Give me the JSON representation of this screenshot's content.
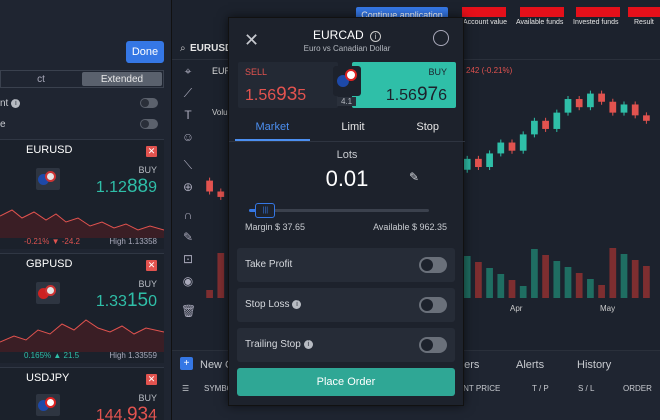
{
  "left_panel": {
    "done_label": "Done",
    "segment": {
      "left_label": "ct",
      "right_label": "Extended"
    },
    "options": [
      {
        "label": "nt",
        "has_info": true
      },
      {
        "label": "e",
        "has_info": false
      }
    ],
    "cards": [
      {
        "symbol": "EURUSD",
        "side": "BUY",
        "price_main": "1.12",
        "price_big": "88",
        "price_tail": "9",
        "price_color": "green",
        "change": "-0.21%",
        "change_abs": "-24.2",
        "change_color": "#e2534f",
        "high": "High 1.13358"
      },
      {
        "symbol": "GBPUSD",
        "side": "BUY",
        "price_main": "1.33",
        "price_big": "15",
        "price_tail": "0",
        "price_color": "green",
        "change": "0.165%",
        "change_abs": "21.5",
        "change_color": "#2fbfa8",
        "high": "High 1.33559"
      },
      {
        "symbol": "USDJPY",
        "side": "BUY",
        "price_main": "144.",
        "price_big": "93",
        "price_tail": "4",
        "price_color": "red",
        "change": "",
        "change_abs": "",
        "change_color": "#e2534f",
        "high": ""
      }
    ]
  },
  "chart_header": {
    "symbol": "EURUSD",
    "button_label": "Continue application",
    "stats": [
      {
        "label": "Account value"
      },
      {
        "label": "Available funds"
      },
      {
        "label": "Invested funds"
      },
      {
        "label": "Result"
      }
    ],
    "legend_text": "242 (-0.21%)",
    "symbol_short": "EUR",
    "volume_short": "Volu"
  },
  "chart_data": {
    "type": "candlestick",
    "x_tick_labels": [
      "Apr",
      "May"
    ],
    "note": "Dense daily candles; bullish green (#2fbfa8), bearish red (#e2534f), with volume bars beneath.",
    "candles": [
      {
        "o": 1.108,
        "c": 1.104
      },
      {
        "o": 1.104,
        "c": 1.102
      },
      {
        "o": 1.102,
        "c": 1.106
      },
      {
        "o": 1.106,
        "c": 1.103
      },
      {
        "o": 1.103,
        "c": 1.1
      },
      {
        "o": 1.1,
        "c": 1.098
      },
      {
        "o": 1.098,
        "c": 1.101
      },
      {
        "o": 1.101,
        "c": 1.097
      },
      {
        "o": 1.097,
        "c": 1.095
      },
      {
        "o": 1.095,
        "c": 1.099
      },
      {
        "o": 1.099,
        "c": 1.096
      },
      {
        "o": 1.096,
        "c": 1.094
      },
      {
        "o": 1.094,
        "c": 1.092
      },
      {
        "o": 1.092,
        "c": 1.096
      },
      {
        "o": 1.096,
        "c": 1.099
      },
      {
        "o": 1.099,
        "c": 1.097
      },
      {
        "o": 1.097,
        "c": 1.101
      },
      {
        "o": 1.101,
        "c": 1.104
      },
      {
        "o": 1.104,
        "c": 1.102
      },
      {
        "o": 1.102,
        "c": 1.106
      },
      {
        "o": 1.106,
        "c": 1.11
      },
      {
        "o": 1.11,
        "c": 1.108
      },
      {
        "o": 1.108,
        "c": 1.112
      },
      {
        "o": 1.112,
        "c": 1.116
      },
      {
        "o": 1.116,
        "c": 1.113
      },
      {
        "o": 1.113,
        "c": 1.118
      },
      {
        "o": 1.118,
        "c": 1.122
      },
      {
        "o": 1.122,
        "c": 1.119
      },
      {
        "o": 1.119,
        "c": 1.125
      },
      {
        "o": 1.125,
        "c": 1.13
      },
      {
        "o": 1.13,
        "c": 1.127
      },
      {
        "o": 1.127,
        "c": 1.133
      },
      {
        "o": 1.133,
        "c": 1.138
      },
      {
        "o": 1.138,
        "c": 1.135
      },
      {
        "o": 1.135,
        "c": 1.14
      },
      {
        "o": 1.14,
        "c": 1.137
      },
      {
        "o": 1.137,
        "c": 1.133
      },
      {
        "o": 1.133,
        "c": 1.136
      },
      {
        "o": 1.136,
        "c": 1.132
      },
      {
        "o": 1.132,
        "c": 1.13
      }
    ],
    "y_range": [
      1.088,
      1.145
    ]
  },
  "order_modal": {
    "title": "EURCAD",
    "subtitle": "Euro vs Canadian Dollar",
    "sell": {
      "label": "SELL",
      "price_main": "1.56",
      "price_big": "93",
      "price_tail": "5"
    },
    "buy": {
      "label": "BUY",
      "price_main": "1.56",
      "price_big": "97",
      "price_tail": "6"
    },
    "spread": "4.1",
    "tabs": [
      {
        "label": "Market",
        "active": true
      },
      {
        "label": "Limit",
        "active": false
      },
      {
        "label": "Stop",
        "active": false
      }
    ],
    "lots_label": "Lots",
    "lots_value": "0.01",
    "slider_fraction": 0.08,
    "margin": "Margin $ 37.65",
    "available": "Available $ 962.35",
    "rows": [
      {
        "label": "Take Profit",
        "has_info": false,
        "enabled": false
      },
      {
        "label": "Stop Loss",
        "has_info": true,
        "enabled": false
      },
      {
        "label": "Trailing Stop",
        "has_info": true,
        "enabled": false
      }
    ],
    "place_label": "Place Order"
  },
  "bottom_panel": {
    "new_order_label": "New O",
    "tabs": [
      {
        "label": "ders"
      },
      {
        "label": "Alerts"
      },
      {
        "label": "History"
      }
    ],
    "columns": [
      {
        "label": "SYMBO"
      },
      {
        "label": "RENT PRICE"
      },
      {
        "label": "T / P"
      },
      {
        "label": "S / L"
      },
      {
        "label": "ORDER"
      }
    ]
  }
}
